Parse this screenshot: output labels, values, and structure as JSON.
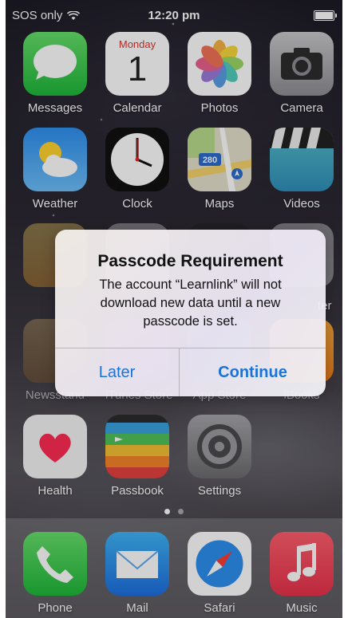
{
  "status_bar": {
    "carrier": "SOS only",
    "time": "12:20 pm"
  },
  "calendar": {
    "weekday": "Monday",
    "day": "1"
  },
  "maps": {
    "route_number": "280"
  },
  "apps": {
    "messages": "Messages",
    "calendar": "Calendar",
    "photos": "Photos",
    "camera": "Camera",
    "weather": "Weather",
    "clock": "Clock",
    "maps": "Maps",
    "videos": "Videos",
    "newsstand": "Newsstand",
    "itunes_store": "iTunes Store",
    "app_store": "App Store",
    "ibooks": "iBooks",
    "health": "Health",
    "passbook": "Passbook",
    "settings": "Settings",
    "partial_label": "ter"
  },
  "dock": {
    "phone": "Phone",
    "mail": "Mail",
    "safari": "Safari",
    "music": "Music"
  },
  "alert": {
    "title": "Passcode Requirement",
    "message": "The account “Learnlink” will not download new data until a new passcode is set.",
    "later": "Later",
    "continue": "Continue"
  },
  "colors": {
    "alert_button": "#1a73d6",
    "messages_green": "#4cd964",
    "music_red": "#fc3158"
  }
}
